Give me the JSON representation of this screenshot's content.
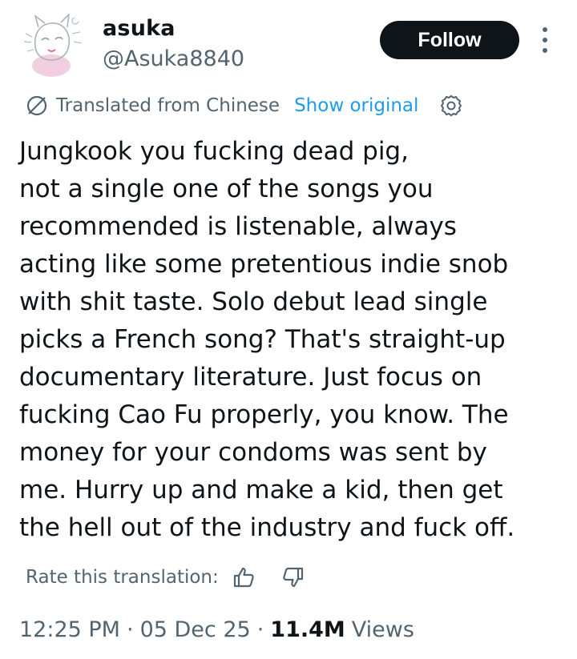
{
  "author": {
    "display_name": "asuka",
    "handle": "@Asuka8840",
    "avatar_icon": "anime-sketch-avatar"
  },
  "actions": {
    "follow_label": "Follow",
    "more_icon": "more-vertical-icon"
  },
  "translation": {
    "icon": "globe-slash-icon",
    "label": "Translated from Chinese",
    "show_original": "Show original",
    "settings_icon": "gear-icon"
  },
  "tweet": {
    "lines": [
      "Jungkook you fucking dead pig,",
      "not a single one of the songs you",
      "recommended is listenable, always",
      "acting like some pretentious indie snob",
      "with shit taste. Solo debut lead single",
      "picks a French song? That's straight-up",
      "documentary literature. Just focus on",
      "fucking Cao Fu properly, you know. The",
      "money for your condoms was sent by",
      "me. Hurry up and make a kid, then get",
      "the hell out of the industry and fuck off."
    ]
  },
  "rating": {
    "label": "Rate this translation:",
    "thumbs_up_icon": "thumbs-up-icon",
    "thumbs_down_icon": "thumbs-down-icon"
  },
  "meta": {
    "time": "12:25 PM",
    "separator": "·",
    "date": "05 Dec 25",
    "views_count": "11.4M",
    "views_label": "Views"
  },
  "colors": {
    "text_primary": "#0f1419",
    "text_secondary": "#536471",
    "link": "#1d9bf0",
    "button_bg": "#0f1419"
  }
}
